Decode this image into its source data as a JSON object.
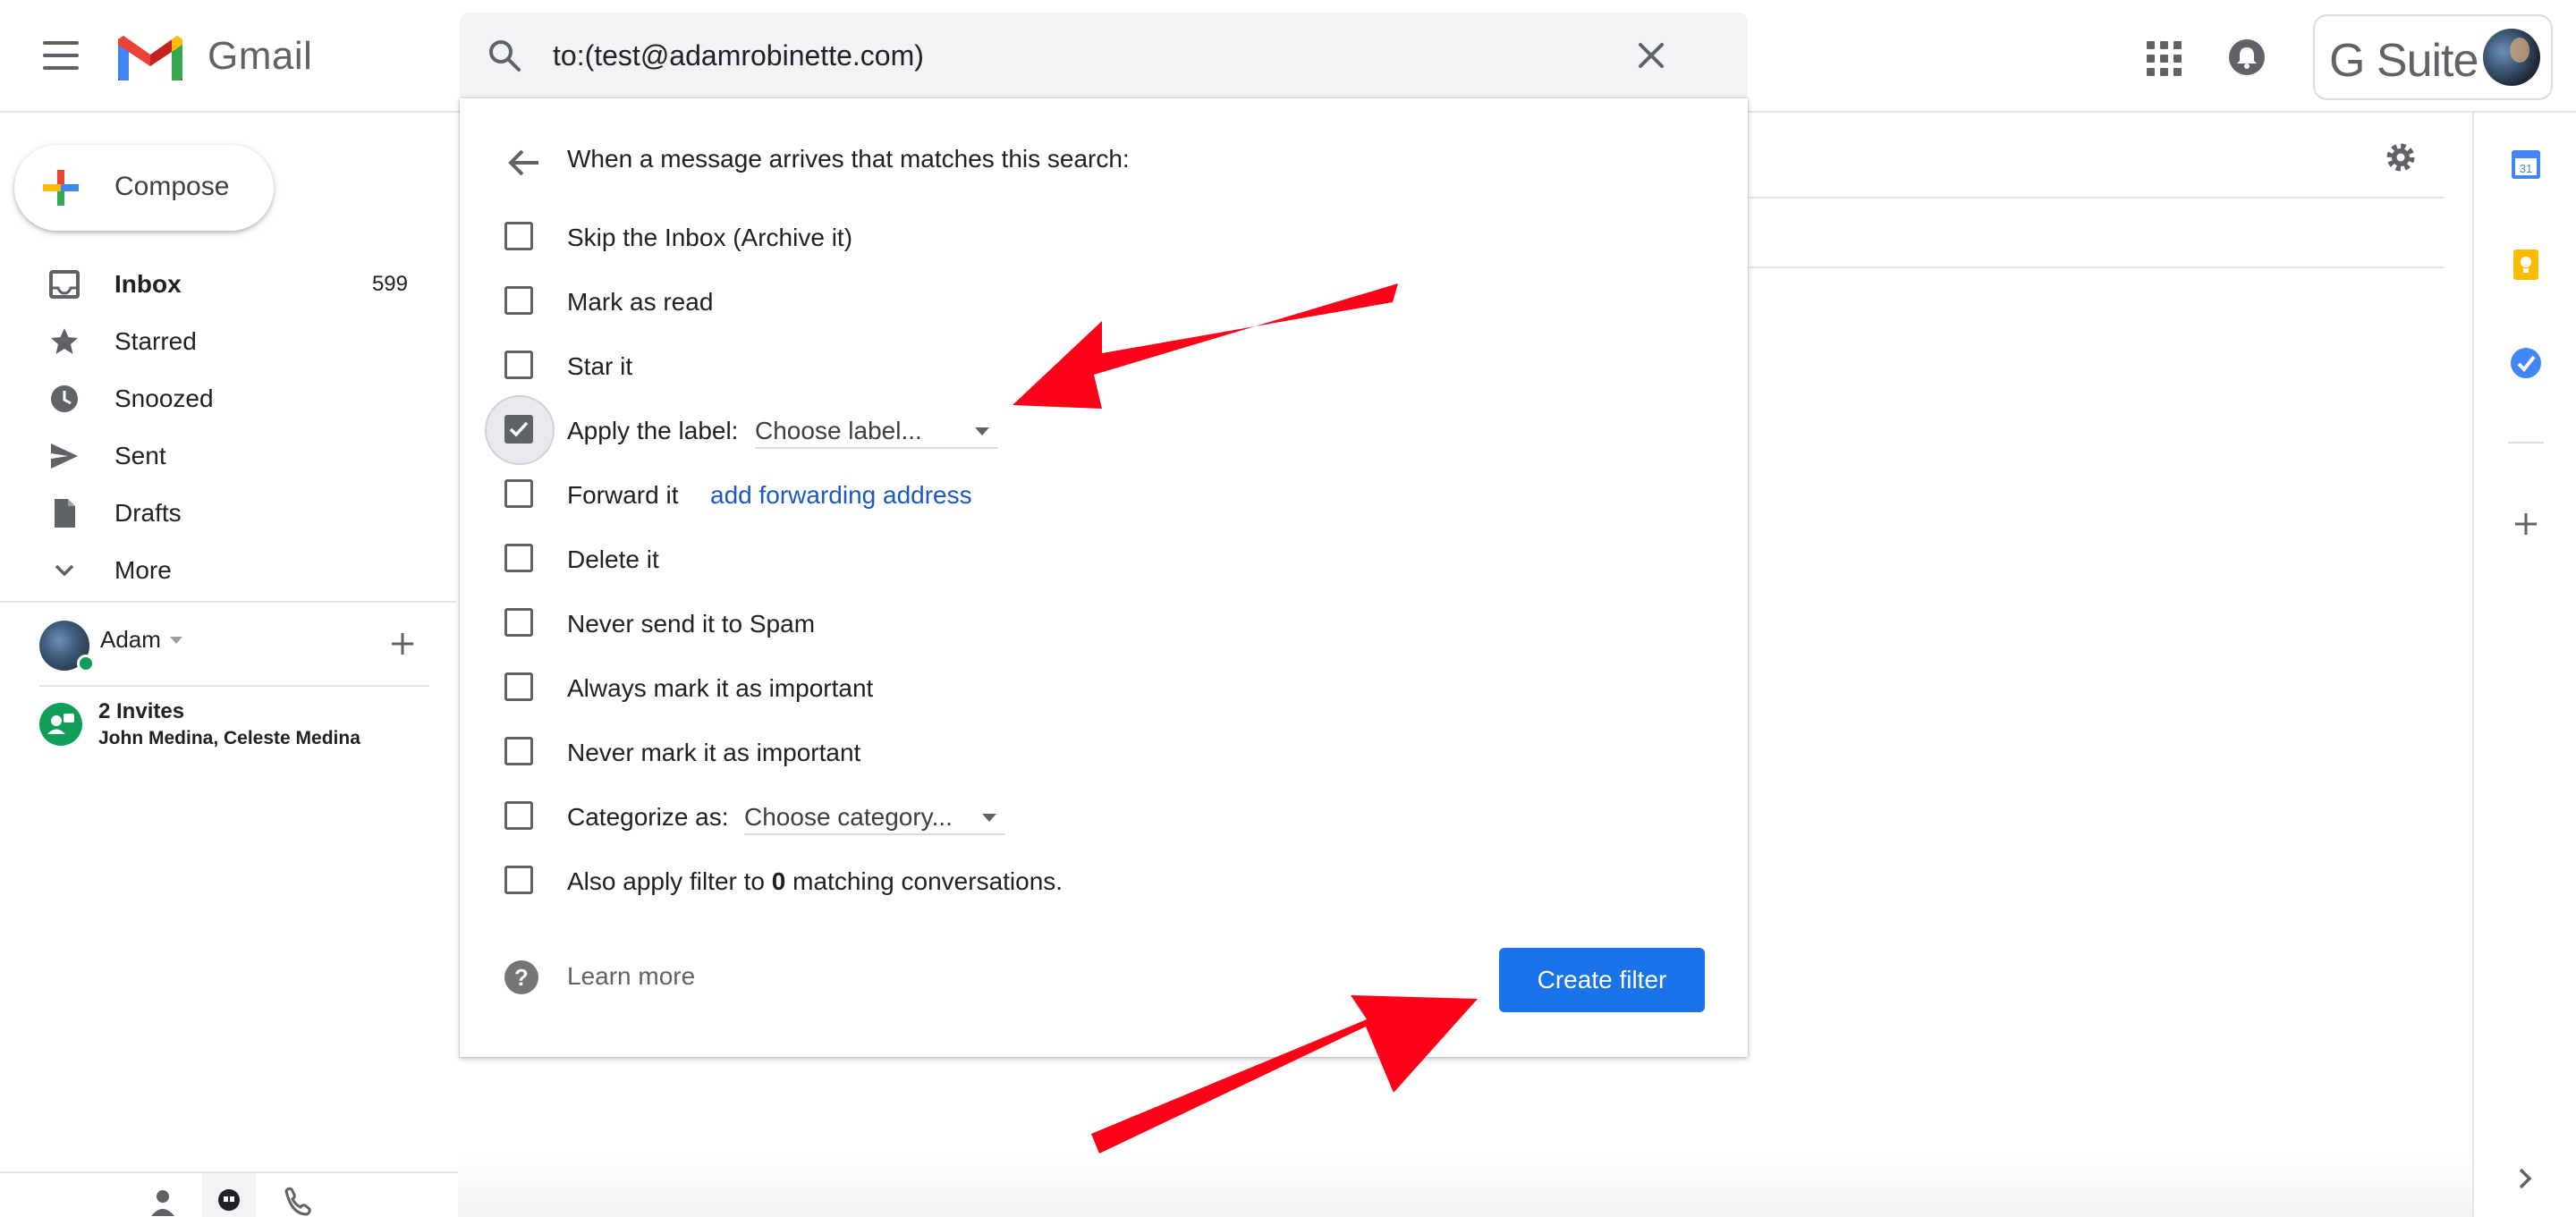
{
  "app": {
    "name": "Gmail",
    "brand_colors": {
      "red": "#EA4335",
      "blue": "#4285F4",
      "green": "#34A853",
      "yellow": "#FBBC04",
      "primary_button": "#1a73e8",
      "link": "#1a57c8"
    }
  },
  "header": {
    "search_query": "to:(test@adamrobinette.com)",
    "gsuite_label": "G Suite",
    "icons": [
      "menu-icon",
      "search-icon",
      "close-icon",
      "apps-icon",
      "bell-icon"
    ]
  },
  "sidebar": {
    "compose_label": "Compose",
    "items": [
      {
        "label": "Inbox",
        "count": "599",
        "icon": "inbox-icon",
        "bold": true
      },
      {
        "label": "Starred",
        "count": "",
        "icon": "star-icon"
      },
      {
        "label": "Snoozed",
        "count": "",
        "icon": "clock-icon"
      },
      {
        "label": "Sent",
        "count": "",
        "icon": "send-icon"
      },
      {
        "label": "Drafts",
        "count": "",
        "icon": "draft-icon"
      },
      {
        "label": "More",
        "count": "",
        "icon": "chevron-down-icon"
      }
    ],
    "hangouts": {
      "user_name": "Adam",
      "invite_title": "2 Invites",
      "invite_names": "John Medina, Celeste Medina"
    }
  },
  "filter": {
    "heading": "When a message arrives that matches this search:",
    "options": [
      {
        "label": "Skip the Inbox (Archive it)",
        "checked": false
      },
      {
        "label": "Mark as read",
        "checked": false
      },
      {
        "label": "Star it",
        "checked": false
      },
      {
        "label": "Apply the label:",
        "checked": true,
        "select": "Choose label..."
      },
      {
        "label": "Forward it",
        "checked": false,
        "link": "add forwarding address"
      },
      {
        "label": "Delete it",
        "checked": false
      },
      {
        "label": "Never send it to Spam",
        "checked": false
      },
      {
        "label": "Always mark it as important",
        "checked": false
      },
      {
        "label": "Never mark it as important",
        "checked": false
      },
      {
        "label": "Categorize as:",
        "checked": false,
        "select": "Choose category..."
      },
      {
        "label_prefix": "Also apply filter to ",
        "label_count": "0",
        "label_suffix": " matching conversations.",
        "checked": false
      }
    ],
    "learn_more": "Learn more",
    "create_button": "Create filter"
  },
  "annotations": {
    "arrow_color": "#ff0019"
  }
}
